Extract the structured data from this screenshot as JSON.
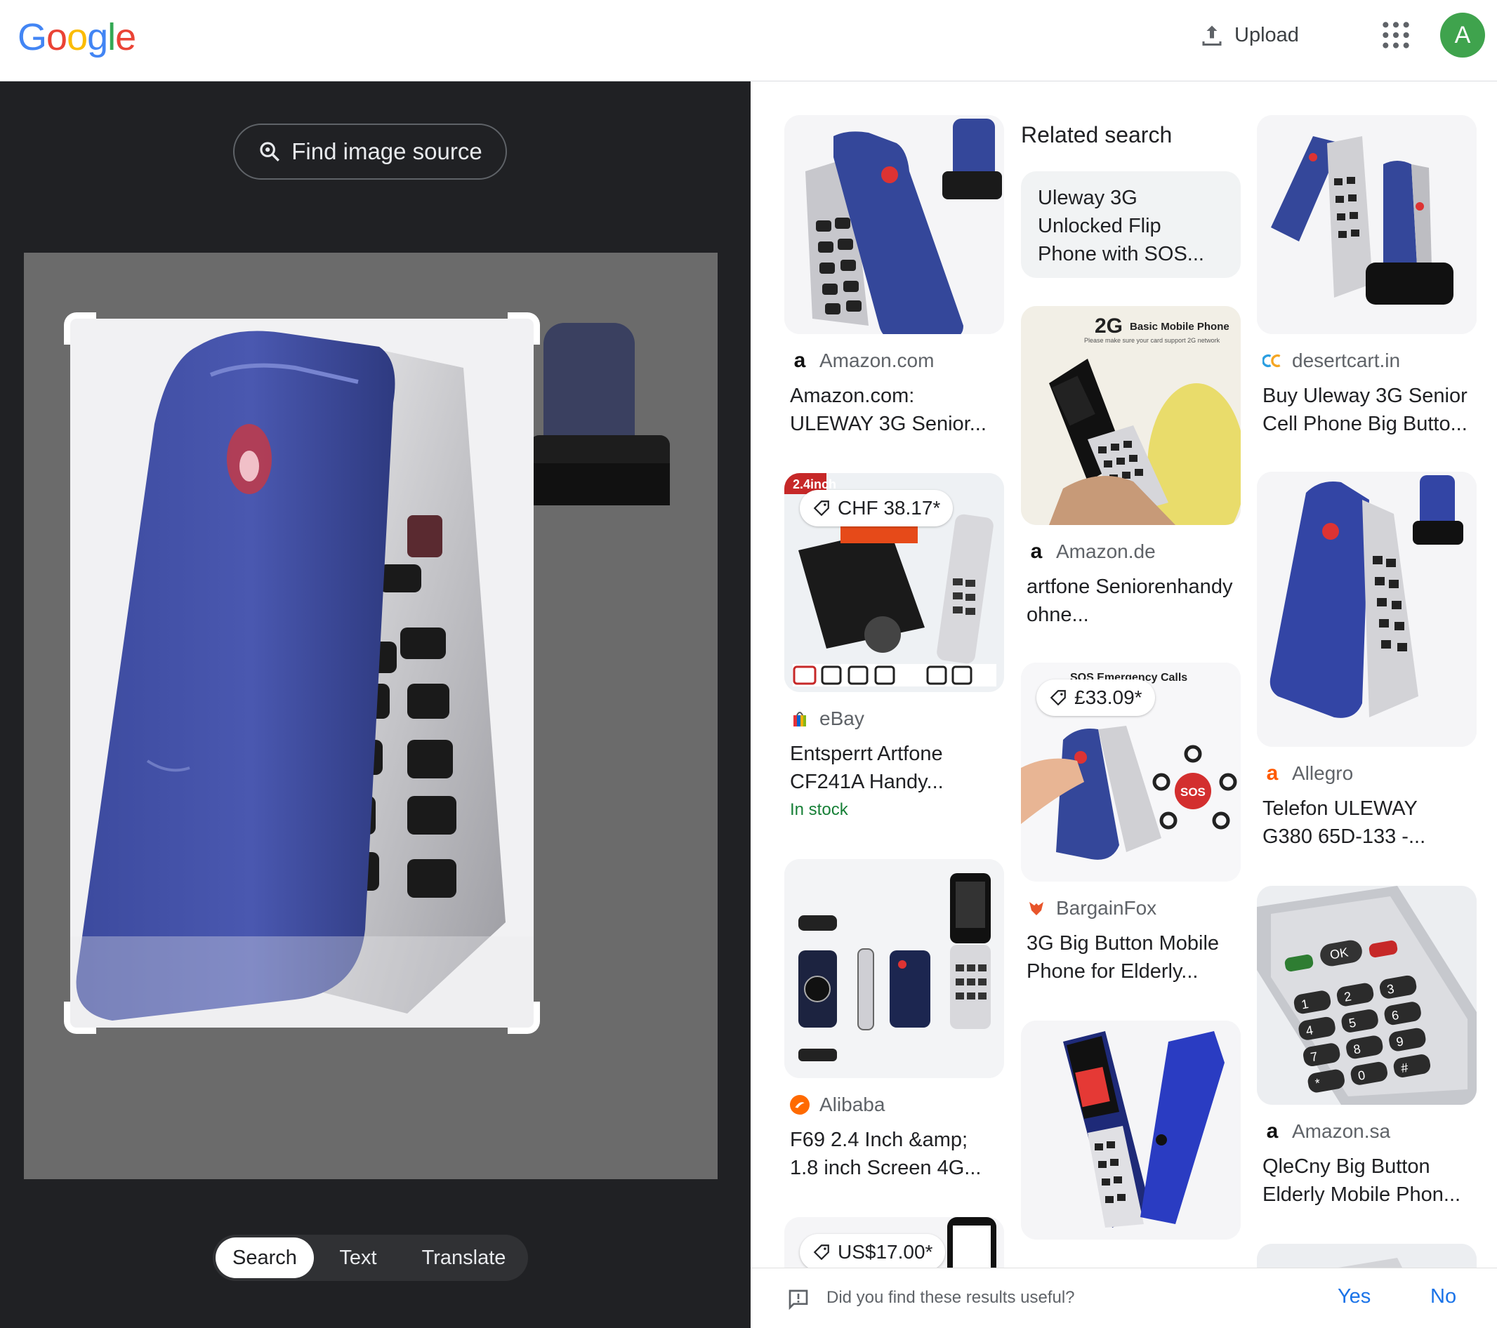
{
  "header": {
    "logo_letters": [
      {
        "ch": "G",
        "color": "#4285F4"
      },
      {
        "ch": "o",
        "color": "#EA4335"
      },
      {
        "ch": "o",
        "color": "#FBBC05"
      },
      {
        "ch": "g",
        "color": "#4285F4"
      },
      {
        "ch": "l",
        "color": "#34A853"
      },
      {
        "ch": "e",
        "color": "#EA4335"
      }
    ],
    "upload_label": "Upload",
    "upload_icon": "upload-icon",
    "apps_icon": "apps-grid-icon",
    "avatar_letter": "A",
    "avatar_color": "#3fa34d"
  },
  "left_panel": {
    "find_source_label": "Find image source",
    "find_source_icon": "lens-search-icon",
    "modes": [
      "Search",
      "Text",
      "Translate"
    ],
    "active_mode": "Search"
  },
  "related": {
    "title": "Related search",
    "chip_text": "Uleway 3G Unlocked Flip Phone with SOS..."
  },
  "results": [
    {
      "source": "Amazon.com",
      "source_icon": "amazon-icon",
      "title": "Amazon.com: ULEWAY 3G Senior...",
      "price": "",
      "stock": ""
    },
    {
      "source": "eBay",
      "source_icon": "ebay-bag-icon",
      "title": "Entsperrt Artfone CF241A Handy...",
      "price": "CHF 38.17*",
      "stock": "In stock"
    },
    {
      "source": "Alibaba",
      "source_icon": "alibaba-icon",
      "title": "F69 2.4 Inch &amp; 1.8 inch Screen 4G...",
      "price": "",
      "stock": ""
    },
    {
      "source": "",
      "source_icon": "",
      "title": "",
      "price": "US$17.00*",
      "stock": ""
    },
    {
      "source": "Amazon.de",
      "source_icon": "amazon-icon",
      "title": "artfone Seniorenhandy ohne...",
      "price": "",
      "stock": ""
    },
    {
      "source": "BargainFox",
      "source_icon": "bargainfox-icon",
      "title": "3G Big Button Mobile Phone for Elderly...",
      "price": "£33.09*",
      "stock": ""
    },
    {
      "source": "desertcart.in",
      "source_icon": "desertcart-icon",
      "title": "Buy Uleway 3G Senior Cell Phone Big Butto...",
      "price": "",
      "stock": ""
    },
    {
      "source": "Allegro",
      "source_icon": "allegro-icon",
      "title": "Telefon ULEWAY G380 65D-133 -...",
      "price": "",
      "stock": ""
    },
    {
      "source": "Amazon.sa",
      "source_icon": "amazon-icon",
      "title": "QleCny Big Button Elderly Mobile Phon...",
      "price": "",
      "stock": ""
    }
  ],
  "thumb_texts": {
    "inch_badge": "2.4inch",
    "basic_phone_big": "2G",
    "basic_phone_small": "Basic Mobile Phone",
    "basic_phone_note": "Please make sure your card support 2G network",
    "sos_header": "SOS Emergency Calls",
    "sos_label": "SOS",
    "ok_key": "OK",
    "keypad_keys": [
      "1",
      "2",
      "3",
      "4",
      "5",
      "6",
      "7",
      "8",
      "9",
      "*",
      "0",
      "#"
    ]
  },
  "feedback": {
    "question": "Did you find these results useful?",
    "yes": "Yes",
    "no": "No",
    "icon": "feedback-icon"
  }
}
